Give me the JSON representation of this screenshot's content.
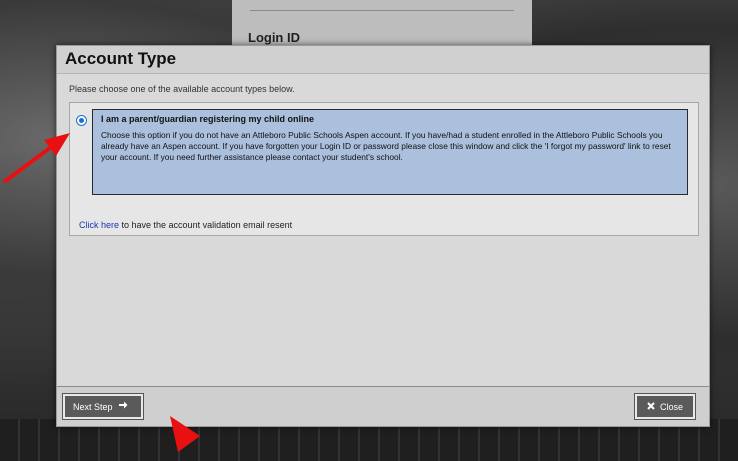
{
  "background": {
    "card_label": "Login ID"
  },
  "dialog": {
    "title": "Account Type",
    "instructions": "Please choose one of the available account types below.",
    "option": {
      "heading": "I am a parent/guardian registering my child online",
      "description": "Choose this option if you do not have an Attleboro Public Schools Aspen account. If you have/had a student enrolled in the Attleboro Public Schools you already have an Aspen account. If you have forgotten your Login ID or password please close this window and click the 'I forgot my password' link to reset your account. If you need further assistance please contact your student's school.",
      "selected": true
    },
    "resend": {
      "link_text": "Click here",
      "rest_text": " to have the account validation email resent"
    },
    "footer": {
      "next_label": "Next Step",
      "close_label": "Close"
    }
  },
  "icons": {
    "next": "arrow-right-icon",
    "close": "x-icon"
  },
  "colors": {
    "option_highlight": "#abc0dd",
    "radio": "#1a6fd6",
    "link": "#1b35b5",
    "annotation": "#e81010"
  }
}
